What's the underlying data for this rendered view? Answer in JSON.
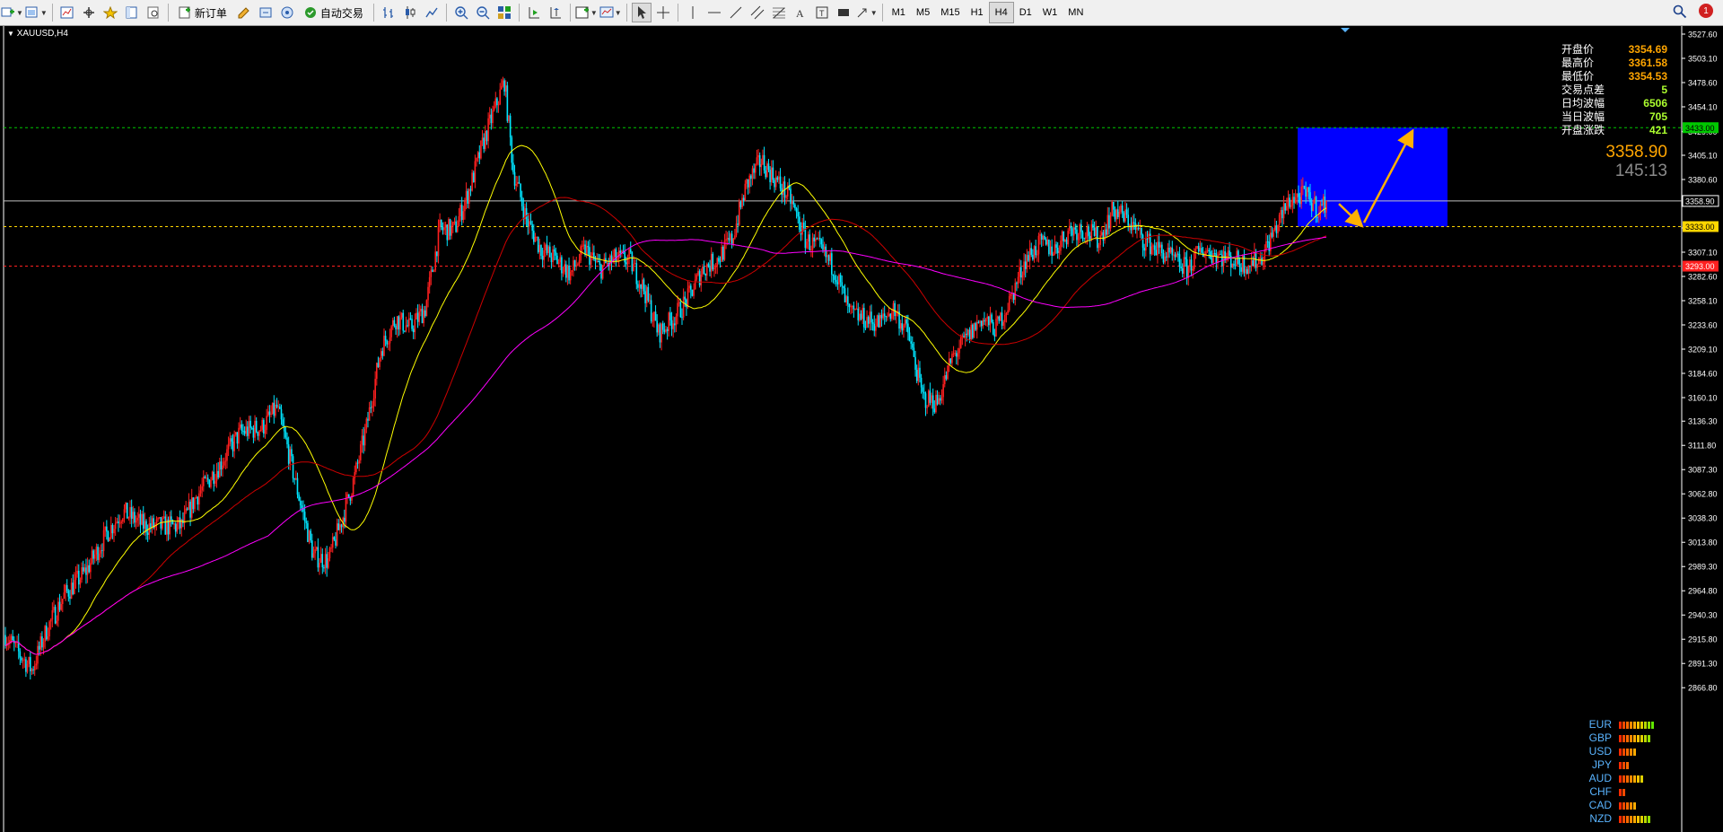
{
  "toolbar": {
    "new_order_label": "新订单",
    "auto_trade_label": "自动交易",
    "timeframes": [
      "M1",
      "M5",
      "M15",
      "H1",
      "H4",
      "D1",
      "W1",
      "MN"
    ],
    "active_timeframe": "H4",
    "icons": [
      "new-chart-icon",
      "profiles-icon",
      "market-watch-icon",
      "navigator-icon",
      "favorites-icon",
      "data-window-icon",
      "strategy-tester-icon",
      "new-order-icon",
      "metaeditor-icon",
      "signals-icon",
      "market-icon",
      "auto-trade-icon",
      "bar-chart-icon",
      "candlestick-icon",
      "line-chart-icon",
      "zoom-in-icon",
      "zoom-out-icon",
      "tile-windows-icon",
      "auto-scroll-icon",
      "chart-shift-icon",
      "indicators-icon",
      "templates-icon",
      "cursor-icon",
      "crosshair-icon",
      "vertical-line-icon",
      "horizontal-line-icon",
      "trendline-icon",
      "fibonacci-icon",
      "equidistant-channel-icon",
      "text-icon",
      "text-label-icon",
      "rectangle-icon",
      "arrows-icon",
      "search-icon"
    ],
    "notification_count": "1"
  },
  "chart": {
    "symbol_label": "XAUUSD,H4",
    "background": "#000000",
    "bull_color": "#ff2020",
    "bear_color": "#00e5ff"
  },
  "quote_panel": {
    "rows": [
      {
        "label": "开盘价",
        "value": "3354.69"
      },
      {
        "label": "最高价",
        "value": "3361.58"
      },
      {
        "label": "最低价",
        "value": "3354.53"
      },
      {
        "label": "交易点差",
        "value": "5"
      },
      {
        "label": "日均波幅",
        "value": "6506"
      },
      {
        "label": "当日波幅",
        "value": "705"
      },
      {
        "label": "开盘涨跌",
        "value": "421"
      }
    ],
    "bid": "3358.90",
    "countdown": "145:13"
  },
  "price_scale": {
    "ticks": [
      "3527.60",
      "3503.10",
      "3478.60",
      "3454.10",
      "3429.00",
      "3405.10",
      "3380.60",
      "3356.10",
      "3331.60",
      "3307.10",
      "3282.60",
      "3258.10",
      "3233.60",
      "3209.10",
      "3184.60",
      "3160.10",
      "3136.30",
      "3111.80",
      "3087.30",
      "3062.80",
      "3038.30",
      "3013.80",
      "2989.30",
      "2964.80",
      "2940.30",
      "2915.80",
      "2891.30",
      "2866.80"
    ],
    "markers": [
      {
        "label": "3433.00",
        "price": 3433.0,
        "color": "#00c800"
      },
      {
        "label": "3358.90",
        "price": 3358.9,
        "color": "#c0c0c0"
      },
      {
        "label": "3333.00",
        "price": 3333.0,
        "color": "#ffd700"
      },
      {
        "label": "3293.00",
        "price": 3293.0,
        "color": "#ff2020"
      }
    ]
  },
  "currency_strength": [
    {
      "currency": "EUR",
      "level": 10
    },
    {
      "currency": "GBP",
      "level": 9
    },
    {
      "currency": "USD",
      "level": 5
    },
    {
      "currency": "JPY",
      "level": 3
    },
    {
      "currency": "AUD",
      "level": 7
    },
    {
      "currency": "CHF",
      "level": 2
    },
    {
      "currency": "CAD",
      "level": 5
    },
    {
      "currency": "NZD",
      "level": 9
    }
  ],
  "annotations": {
    "zone": {
      "price_high": 3433.0,
      "price_low": 3333.0,
      "color": "#0000ff"
    },
    "arrow_color": "#ffb000"
  },
  "moving_averages": [
    {
      "color": "#ffff00"
    },
    {
      "color": "#cc0000"
    },
    {
      "color": "#ff00ff"
    }
  ]
}
